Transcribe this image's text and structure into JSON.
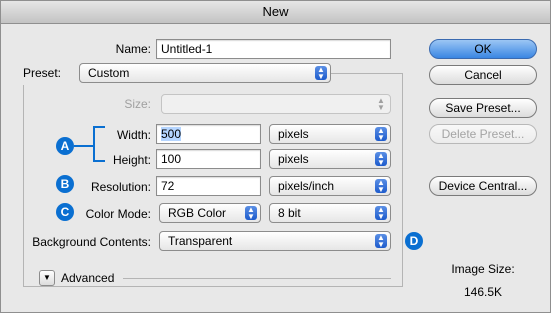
{
  "window": {
    "title": "New"
  },
  "name": {
    "label": "Name:",
    "value": "Untitled-1"
  },
  "preset": {
    "label": "Preset:",
    "value": "Custom"
  },
  "size": {
    "label": "Size:",
    "value": ""
  },
  "width": {
    "label": "Width:",
    "value": "500",
    "unit": "pixels"
  },
  "height": {
    "label": "Height:",
    "value": "100",
    "unit": "pixels"
  },
  "resolution": {
    "label": "Resolution:",
    "value": "72",
    "unit": "pixels/inch"
  },
  "color_mode": {
    "label": "Color Mode:",
    "value": "RGB Color",
    "depth": "8 bit"
  },
  "background": {
    "label": "Background Contents:",
    "value": "Transparent"
  },
  "advanced": {
    "label": "Advanced"
  },
  "buttons": {
    "ok": "OK",
    "cancel": "Cancel",
    "save_preset": "Save Preset...",
    "delete_preset": "Delete Preset...",
    "device_central": "Device Central..."
  },
  "image_size": {
    "label": "Image Size:",
    "value": "146.5K"
  },
  "badges": {
    "a": "A",
    "b": "B",
    "c": "C",
    "d": "D"
  },
  "colors": {
    "accent": "#0a6fd1",
    "default_button": "#3a86e3"
  }
}
